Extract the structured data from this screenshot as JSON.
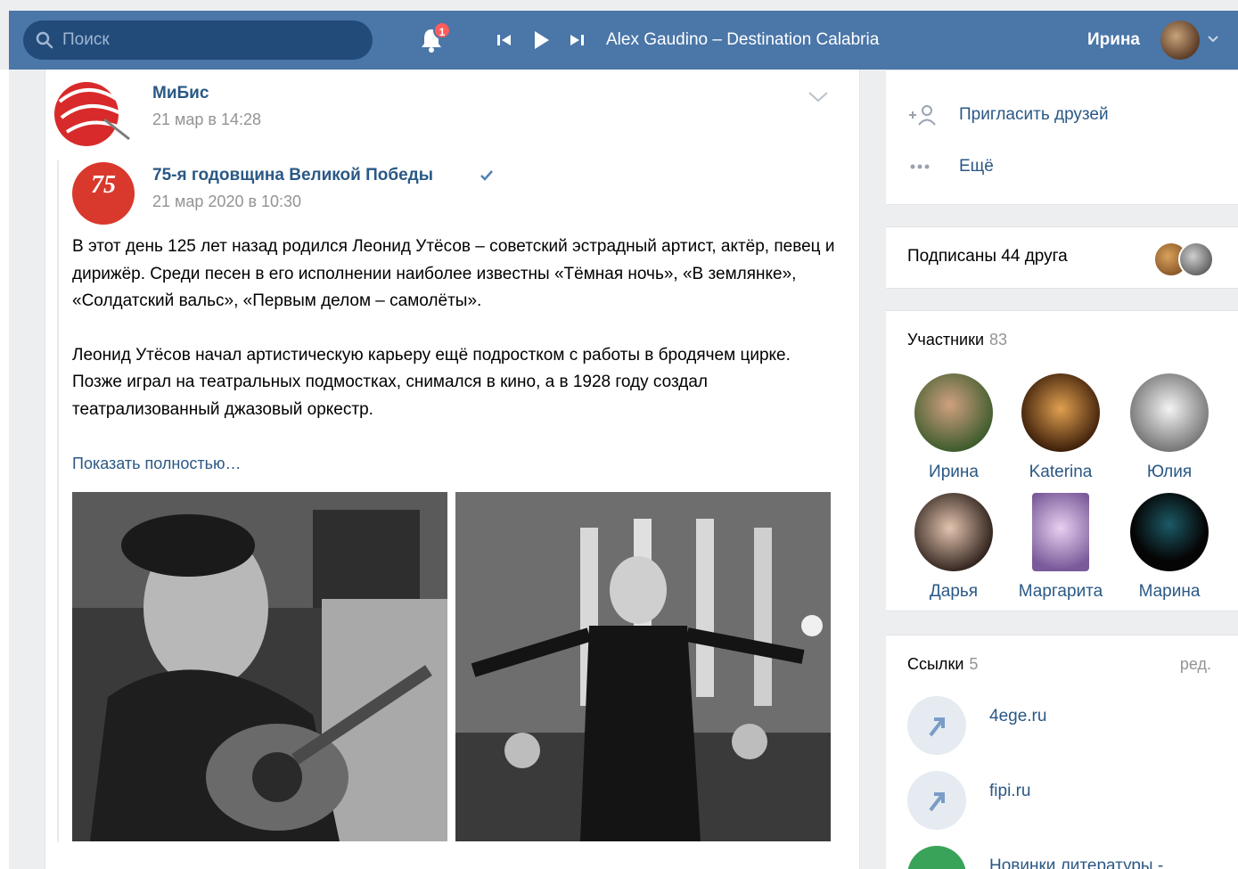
{
  "topbar": {
    "search_placeholder": "Поиск",
    "notifications_badge": "1",
    "track": "Alex Gaudino – Destination Calabria",
    "username": "Ирина"
  },
  "post": {
    "group_name": "МиБис",
    "time": "21 мар в 14:28",
    "original": {
      "group_name": "75-я годовщина Великой Победы",
      "logo_text": "75",
      "time": "21 мар 2020 в 10:30",
      "paragraph_1": "В этот день 125 лет назад родился Леонид Утёсов – советский эстрадный артист, актёр, певец и дирижёр. Среди песен в его исполнении наиболее известны «Тёмная ночь», «В землянке», «Солдатский вальс», «Первым делом – самолёты».",
      "paragraph_2": "Леонид Утёсов начал артистическую карьеру ещё подростком с работы в бродячем цирке. Позже играл на театральных подмостках, снимался в кино, а в 1928 году создал театрализованный джазовый оркестр.",
      "show_more": "Показать полностью…"
    }
  },
  "sidebar": {
    "menu": [
      {
        "icon": "+",
        "label": "Пригласить друзей"
      },
      {
        "icon": "•••",
        "label": "Ещё"
      }
    ],
    "friends_subscribed": "Подписаны 44 друга",
    "members": {
      "title": "Участники",
      "count": "83",
      "list": [
        {
          "name": "Ирина",
          "color": "#8a5a3c"
        },
        {
          "name": "Katerina",
          "color": "#7a4a1a"
        },
        {
          "name": "Юлия",
          "color": "#9a9a9a"
        },
        {
          "name": "Дарья",
          "color": "#5a4a40"
        },
        {
          "name": "Маргарита",
          "color": "#b89ac8"
        },
        {
          "name": "Марина",
          "color": "#111111"
        }
      ]
    },
    "links": {
      "title": "Ссылки",
      "count": "5",
      "edit": "ред.",
      "list": [
        {
          "label": "4ege.ru"
        },
        {
          "label": "fipi.ru"
        },
        {
          "label": "Новинки литературы -"
        }
      ]
    }
  },
  "colors": {
    "header": "#4a76a8",
    "link": "#2a5885",
    "muted": "#939393"
  }
}
